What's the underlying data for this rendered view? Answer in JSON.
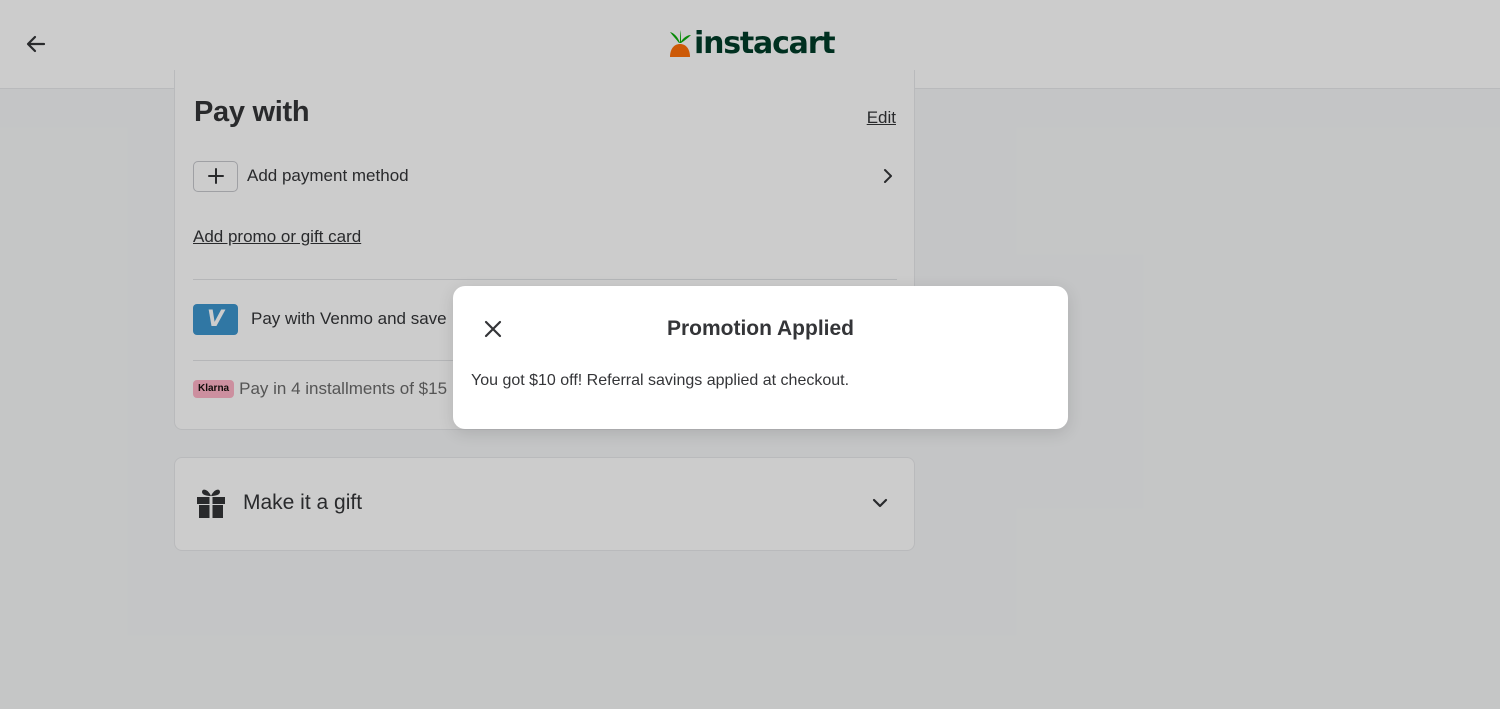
{
  "header": {
    "back_icon": "arrow-left-icon",
    "logo_text": "instacart",
    "brand_colors": {
      "carrot_green": "#0aad0a",
      "carrot_orange": "#ff7009",
      "wordmark": "#003d29"
    }
  },
  "payment": {
    "title": "Pay with",
    "edit_label": "Edit",
    "add_payment_label": "Add payment method",
    "promo_label": "Add promo or gift card",
    "venmo_badge": "V",
    "venmo_label": "Pay with Venmo and save",
    "klarna_badge": "Klarna",
    "klarna_text": "Pay in 4 installments of $15"
  },
  "gift": {
    "label": "Make it a gift"
  },
  "modal": {
    "title": "Promotion Applied",
    "body": "You got $10 off! Referral savings applied at checkout."
  },
  "colors": {
    "page_bg": "#f6f7f8",
    "text": "#343538",
    "venmo": "#3d95ce",
    "klarna": "#ffb3c7",
    "overlay": "rgba(0,0,0,0.2)"
  }
}
